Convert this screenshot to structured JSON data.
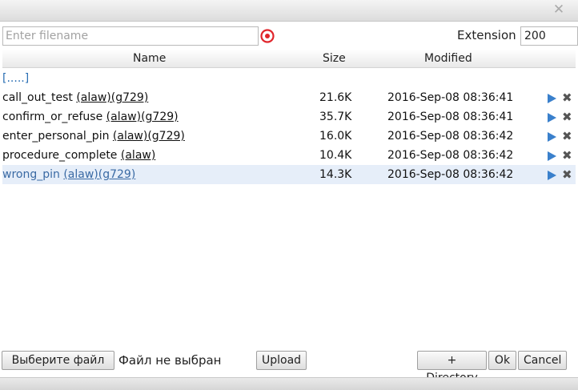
{
  "dialog": {
    "close_glyph": "✕"
  },
  "toolbar": {
    "filename_placeholder": "Enter filename",
    "filename_value": "",
    "extension_label": "Extension",
    "extension_value": "200"
  },
  "columns": {
    "name": "Name",
    "size": "Size",
    "modified": "Modified"
  },
  "parent_link": "[.....]",
  "files": [
    {
      "name": "call_out_test",
      "formats": "(alaw)(g729)",
      "size": "21.6K",
      "modified": "2016-Sep-08 08:36:41"
    },
    {
      "name": "confirm_or_refuse",
      "formats": "(alaw)(g729)",
      "size": "35.7K",
      "modified": "2016-Sep-08 08:36:41"
    },
    {
      "name": "enter_personal_pin",
      "formats": "(alaw)(g729)",
      "size": "16.0K",
      "modified": "2016-Sep-08 08:36:42"
    },
    {
      "name": "procedure_complete",
      "formats": "(alaw)",
      "size": "10.4K",
      "modified": "2016-Sep-08 08:36:42"
    },
    {
      "name": "wrong_pin",
      "formats": "(alaw)(g729)",
      "size": "14.3K",
      "modified": "2016-Sep-08 08:36:42",
      "selected": true
    }
  ],
  "row_icons": {
    "play": "play-icon",
    "delete": "delete-icon"
  },
  "footer": {
    "choose_file_label": "Выберите файл",
    "no_file_text": "Файл не выбран",
    "upload_label": "Upload",
    "directory_label": "+ Directory",
    "ok_label": "Ok",
    "cancel_label": "Cancel"
  },
  "colors": {
    "link": "#2a6fb4",
    "selected_row_bg": "#e6eef9",
    "play_icon": "#3a80cc",
    "target_icon": "#e0252b"
  }
}
